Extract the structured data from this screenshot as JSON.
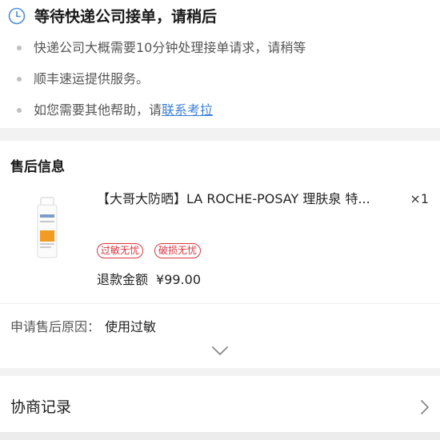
{
  "status": {
    "title": "等待快递公司接单，请稍后",
    "icon": "clock-icon",
    "lines": [
      "快递公司大概需要10分钟处理接单请求，请稍等",
      "顺丰速运提供服务。"
    ],
    "help_prefix": "如您需要其他帮助，请",
    "help_link": "联系考拉"
  },
  "aftersale": {
    "section_title": "售后信息",
    "product": {
      "name": "【大哥大防晒】LA ROCHE-POSAY 理肤泉 特...",
      "qty": "×1",
      "tags": [
        "过敏无忧",
        "破损无忧"
      ]
    },
    "refund_label": "退款金额",
    "refund_amount": "¥99.00",
    "reason_label": "申请售后原因：",
    "reason_value": "使用过敏"
  },
  "negotiation": {
    "title": "协商记录"
  },
  "colors": {
    "tag_red": "#d9363e",
    "link_blue": "#3b7fd8",
    "page_bg": "#f2f2f2"
  }
}
